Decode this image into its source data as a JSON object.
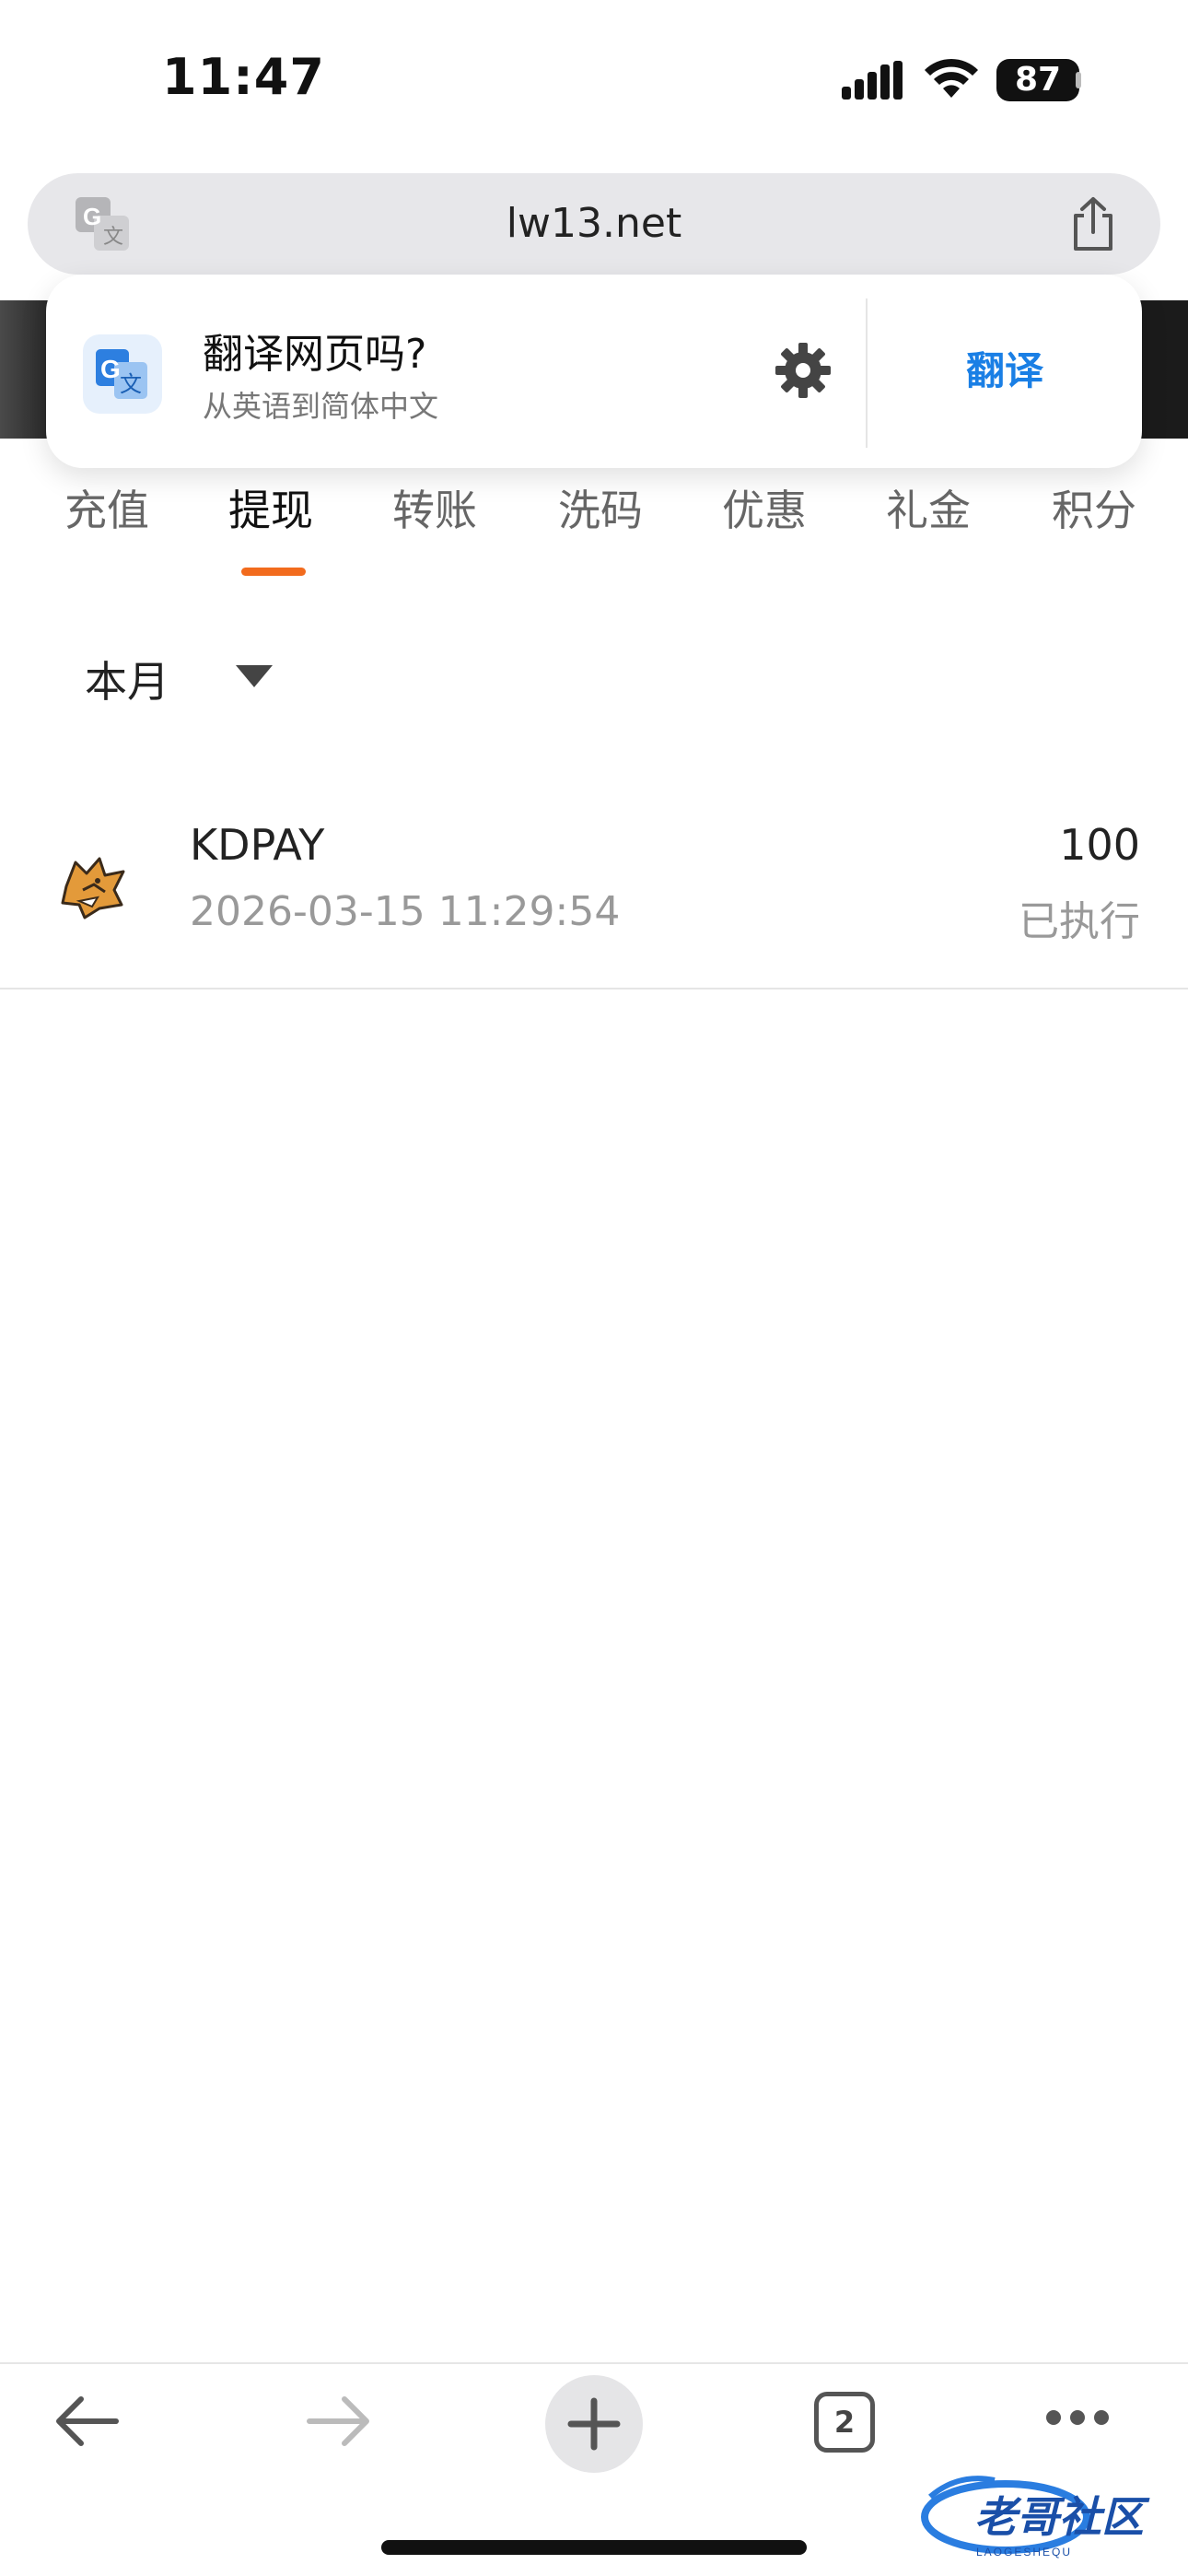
{
  "status_bar": {
    "time": "11:47",
    "battery": "87"
  },
  "browser": {
    "url": "lw13.net",
    "tab_count": "2"
  },
  "translate_popup": {
    "title": "翻译网页吗?",
    "subtitle": "从英语到简体中文",
    "action_label": "翻译"
  },
  "tabs": [
    {
      "label": "充值"
    },
    {
      "label": "提现"
    },
    {
      "label": "转账"
    },
    {
      "label": "洗码"
    },
    {
      "label": "优惠"
    },
    {
      "label": "礼金"
    },
    {
      "label": "积分"
    }
  ],
  "active_tab": "提现",
  "filter": {
    "selected": "本月"
  },
  "records": [
    {
      "name": "KDPAY",
      "datetime": "2026-03-15 11:29:54",
      "amount": "100",
      "status": "已执行"
    }
  ],
  "watermark": {
    "text": "老哥社区",
    "subtext": "LAOGESHEQU"
  },
  "colors": {
    "accent": "#f26b1d",
    "link_blue": "#1a7fe5"
  }
}
